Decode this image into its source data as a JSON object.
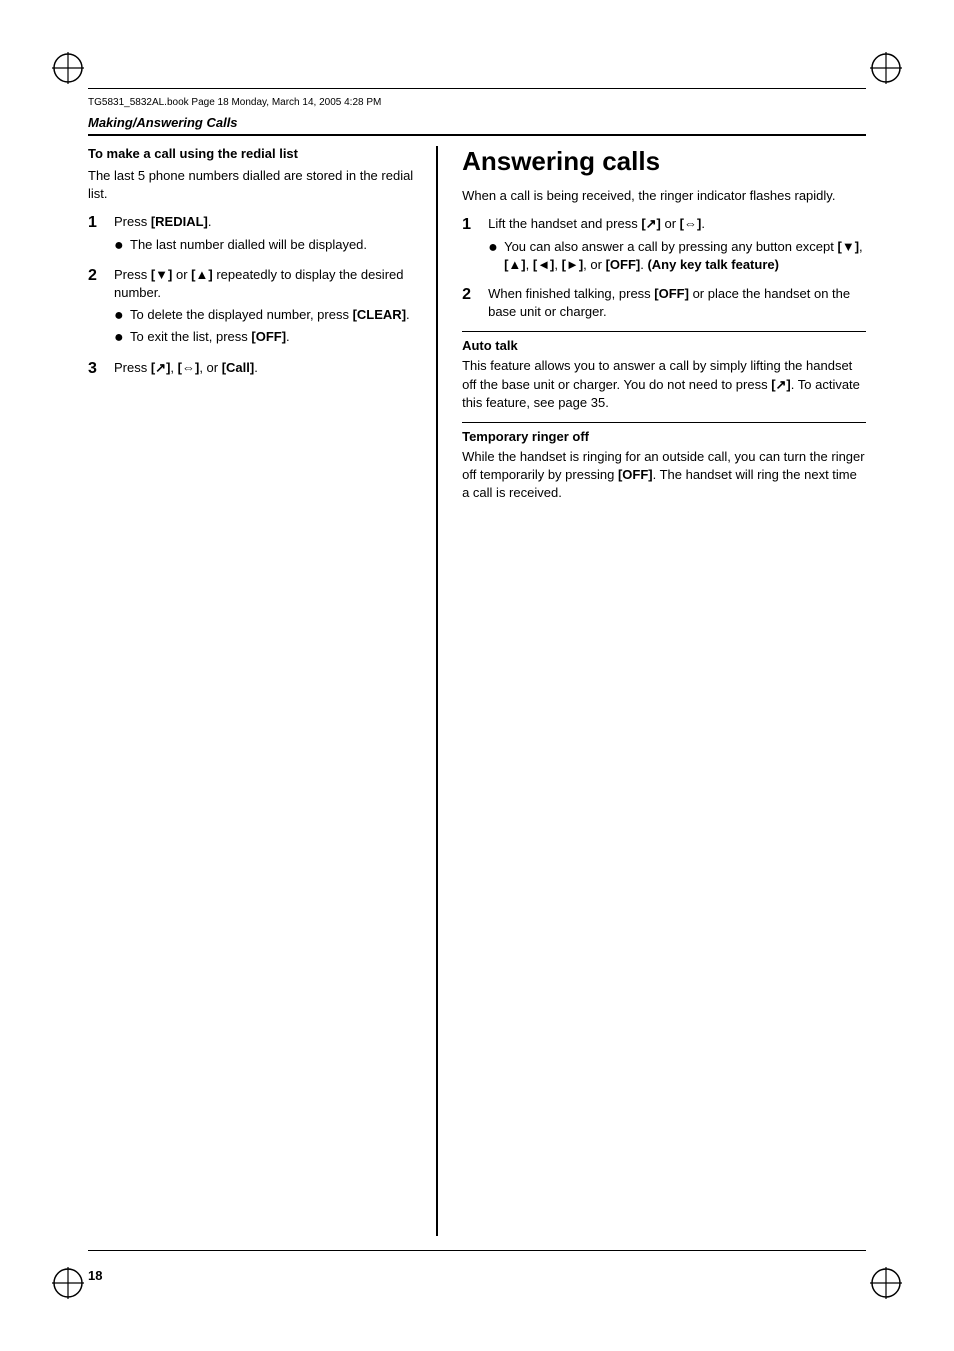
{
  "header": {
    "file_info": "TG5831_5832AL.book  Page 18  Monday, March 14, 2005  4:28 PM"
  },
  "section": {
    "heading": "Making/Answering Calls"
  },
  "left_col": {
    "subsection_title": "To make a call using the redial list",
    "intro": "The last 5 phone numbers dialled are stored in the redial list.",
    "steps": [
      {
        "number": "1",
        "text": "Press ",
        "key": "[REDIAL]",
        "text_after": ".",
        "bullets": [
          {
            "text": "The last number dialled will be displayed."
          }
        ]
      },
      {
        "number": "2",
        "text": "Press ",
        "key1": "[▼]",
        "text_mid": " or ",
        "key2": "[▲]",
        "text_after": " repeatedly to display the desired number.",
        "bullets": [
          {
            "text": "To delete the displayed number, press ",
            "key": "[CLEAR]",
            "text_after": "."
          },
          {
            "text": "To exit the list, press ",
            "key": "[OFF]",
            "text_after": "."
          }
        ]
      },
      {
        "number": "3",
        "text": "Press ",
        "keys": "[  ↗  ], [⇔], or [Call]",
        "text_after": "."
      }
    ]
  },
  "right_col": {
    "main_heading": "Answering calls",
    "intro": "When a call is being received, the ringer indicator flashes rapidly.",
    "steps": [
      {
        "number": "1",
        "text": "Lift the handset and press ",
        "key1": "[ ↗ ]",
        "text_mid": " or ",
        "key2": "[⇔]",
        "text_after": ".",
        "bullets": [
          {
            "text": "You can also answer a call by pressing any button except ",
            "key_seq": "[▼], [▲], [◄], [►]",
            "text_after": ", or ",
            "key_last": "[OFF]",
            "text_end": ". ",
            "bold_text": "(Any key talk feature)"
          }
        ]
      },
      {
        "number": "2",
        "text": "When finished talking, press ",
        "key": "[OFF]",
        "text_mid": " or place the handset on the base unit or charger.",
        "bullets": []
      }
    ],
    "auto_talk": {
      "heading": "Auto talk",
      "text": "This feature allows you to answer a call by simply lifting the handset off the base unit or charger. You do not need to press [  ↗  ]. To activate this feature, see page 35."
    },
    "temp_ringer": {
      "heading": "Temporary ringer off",
      "text": "While the handset is ringing for an outside call, you can turn the ringer off temporarily by pressing [OFF]. The handset will ring the next time a call is received."
    }
  },
  "page_number": "18"
}
